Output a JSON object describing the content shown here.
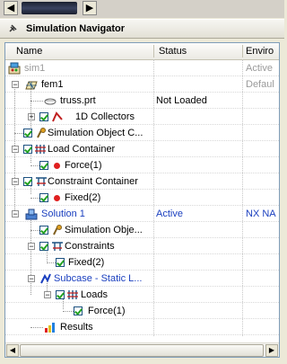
{
  "header": {
    "title": "Simulation Navigator"
  },
  "columns": {
    "name": "Name",
    "status": "Status",
    "environment": "Enviro"
  },
  "tree": {
    "sim1": {
      "label": "sim1",
      "env": "Active"
    },
    "fem1": {
      "label": "fem1",
      "env": "Defaul"
    },
    "truss": {
      "label": "truss.prt",
      "status": "Not Loaded"
    },
    "collectors": {
      "label": "1D Collectors"
    },
    "sim_object_container": {
      "label": "Simulation Object C..."
    },
    "load_container": {
      "label": "Load Container"
    },
    "force1": {
      "label": "Force(1)"
    },
    "constraint_container": {
      "label": "Constraint Container"
    },
    "fixed2": {
      "label": "Fixed(2)"
    },
    "solution1": {
      "label": "Solution 1",
      "status": "Active",
      "env": "NX NA"
    },
    "sim_objects": {
      "label": "Simulation Obje..."
    },
    "constraints": {
      "label": "Constraints"
    },
    "fixed2b": {
      "label": "Fixed(2)"
    },
    "subcase": {
      "label": "Subcase - Static L..."
    },
    "loads": {
      "label": "Loads"
    },
    "force1b": {
      "label": "Force(1)"
    },
    "results": {
      "label": "Results"
    }
  },
  "icons": [
    "nav-pin-icon",
    "sim-icon",
    "fem-icon",
    "part-icon",
    "collector-icon",
    "sim-object-icon",
    "load-icon",
    "constraint-icon",
    "solution-icon",
    "results-icon"
  ],
  "colors": {
    "link_blue": "#1a3fbf",
    "inactive_grey": "#9a9a9a",
    "check_green": "#21a121",
    "load_red": "#e02020"
  }
}
